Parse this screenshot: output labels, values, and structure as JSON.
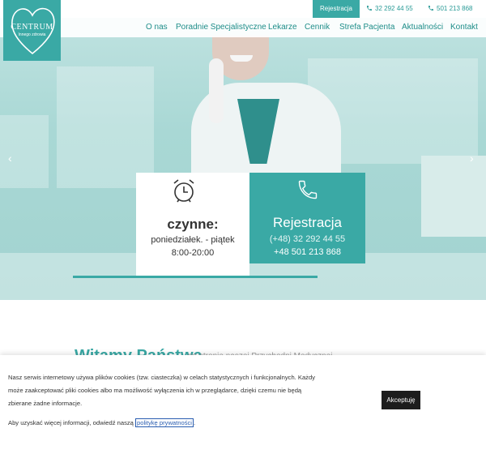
{
  "topbar": {
    "register_label": "Rejestracja",
    "phone1": "32 292 44 55",
    "phone2": "501 213 868"
  },
  "logo": {
    "brand": "CENTRUM",
    "tagline": "Innego zdrowia"
  },
  "nav": {
    "items": [
      "O nas",
      "Poradnie Specjalistyczne",
      "Lekarze",
      "Cennik",
      "Strefa Pacjenta",
      "Aktualności",
      "Kontakt"
    ]
  },
  "hours_card": {
    "title": "czynne:",
    "days": "poniedziałek. - piątek",
    "hours": "8:00-20:00"
  },
  "register_card": {
    "title": "Rejestracja",
    "phone1": "(+48) 32 292 44 55",
    "phone2": "+48 501 213 868"
  },
  "welcome": {
    "title": "Witamy Państwa",
    "subtitle": "na stronie naszej Przychodni Medycznej"
  },
  "cookie": {
    "text": "Nasz serwis internetowy używa plików cookies (tzw. ciasteczka) w celach statystycznych i funkcjonalnych. Każdy może zaakceptować pliki cookies albo ma możliwość wyłączenia ich w przeglądarce, dzięki czemu nie będą zbierane żadne informacje.",
    "more_prefix": "Aby uzyskać więcej informacji, odwiedź naszą",
    "policy_link": "politykę prywatności",
    "policy_suffix": ".",
    "accept_label": "Akceptuję"
  },
  "colors": {
    "accent": "#3aa9a5",
    "dark_button": "#1d1d1d"
  }
}
